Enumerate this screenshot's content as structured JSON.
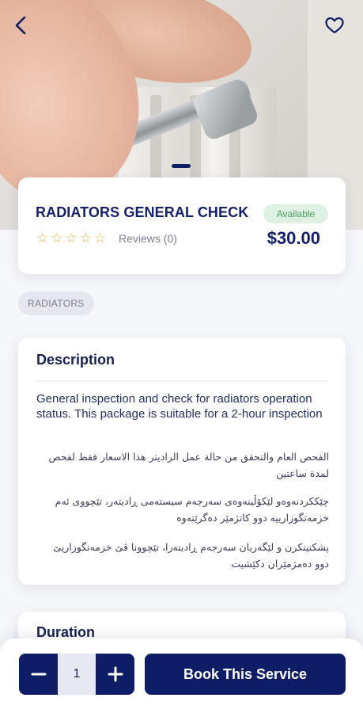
{
  "header": {
    "back_icon": "chevron-left-icon",
    "favorite_icon": "heart-icon"
  },
  "product": {
    "title": "RADIATORS GENERAL CHECK",
    "availability": "Available",
    "rating_stars": 0,
    "rating_max": 5,
    "reviews_label": "Reviews (0)",
    "price": "$30.00",
    "colors": {
      "primary": "#0f1d66",
      "badge_bg": "#dff1e2",
      "badge_text": "#47a05a",
      "star": "#e2b246"
    }
  },
  "category_tag": "RADIATORS",
  "description": {
    "title": "Description",
    "english": "General inspection and check for radiators operation status. This package is suitable for a 2-hour inspection",
    "arabic": "الفحص العام والتحقق من حالة عمل الراديتر هذا الاسعار فقط لفحص لمدة ساعتين",
    "kurdish_sorani": "چێککردنەوەو لێکۆڵینەوەی سەرجەم سیستەمی ڕادیتەر، تێچووی ئەم خزمەتگوزارییە دوو کاتژمێر دەگرێتەوە",
    "kurdish_badini": "پشکنینکرن و لێگەریان سەرجەم ڕادیتەرا، تێچوونا ڤێ خزمەتگوزاریێ دوو دەمژمێران دکێشیت"
  },
  "duration": {
    "title": "Duration"
  },
  "bottom_bar": {
    "quantity": "1",
    "decrement_icon": "minus-icon",
    "increment_icon": "plus-icon",
    "book_label": "Book This Service"
  }
}
